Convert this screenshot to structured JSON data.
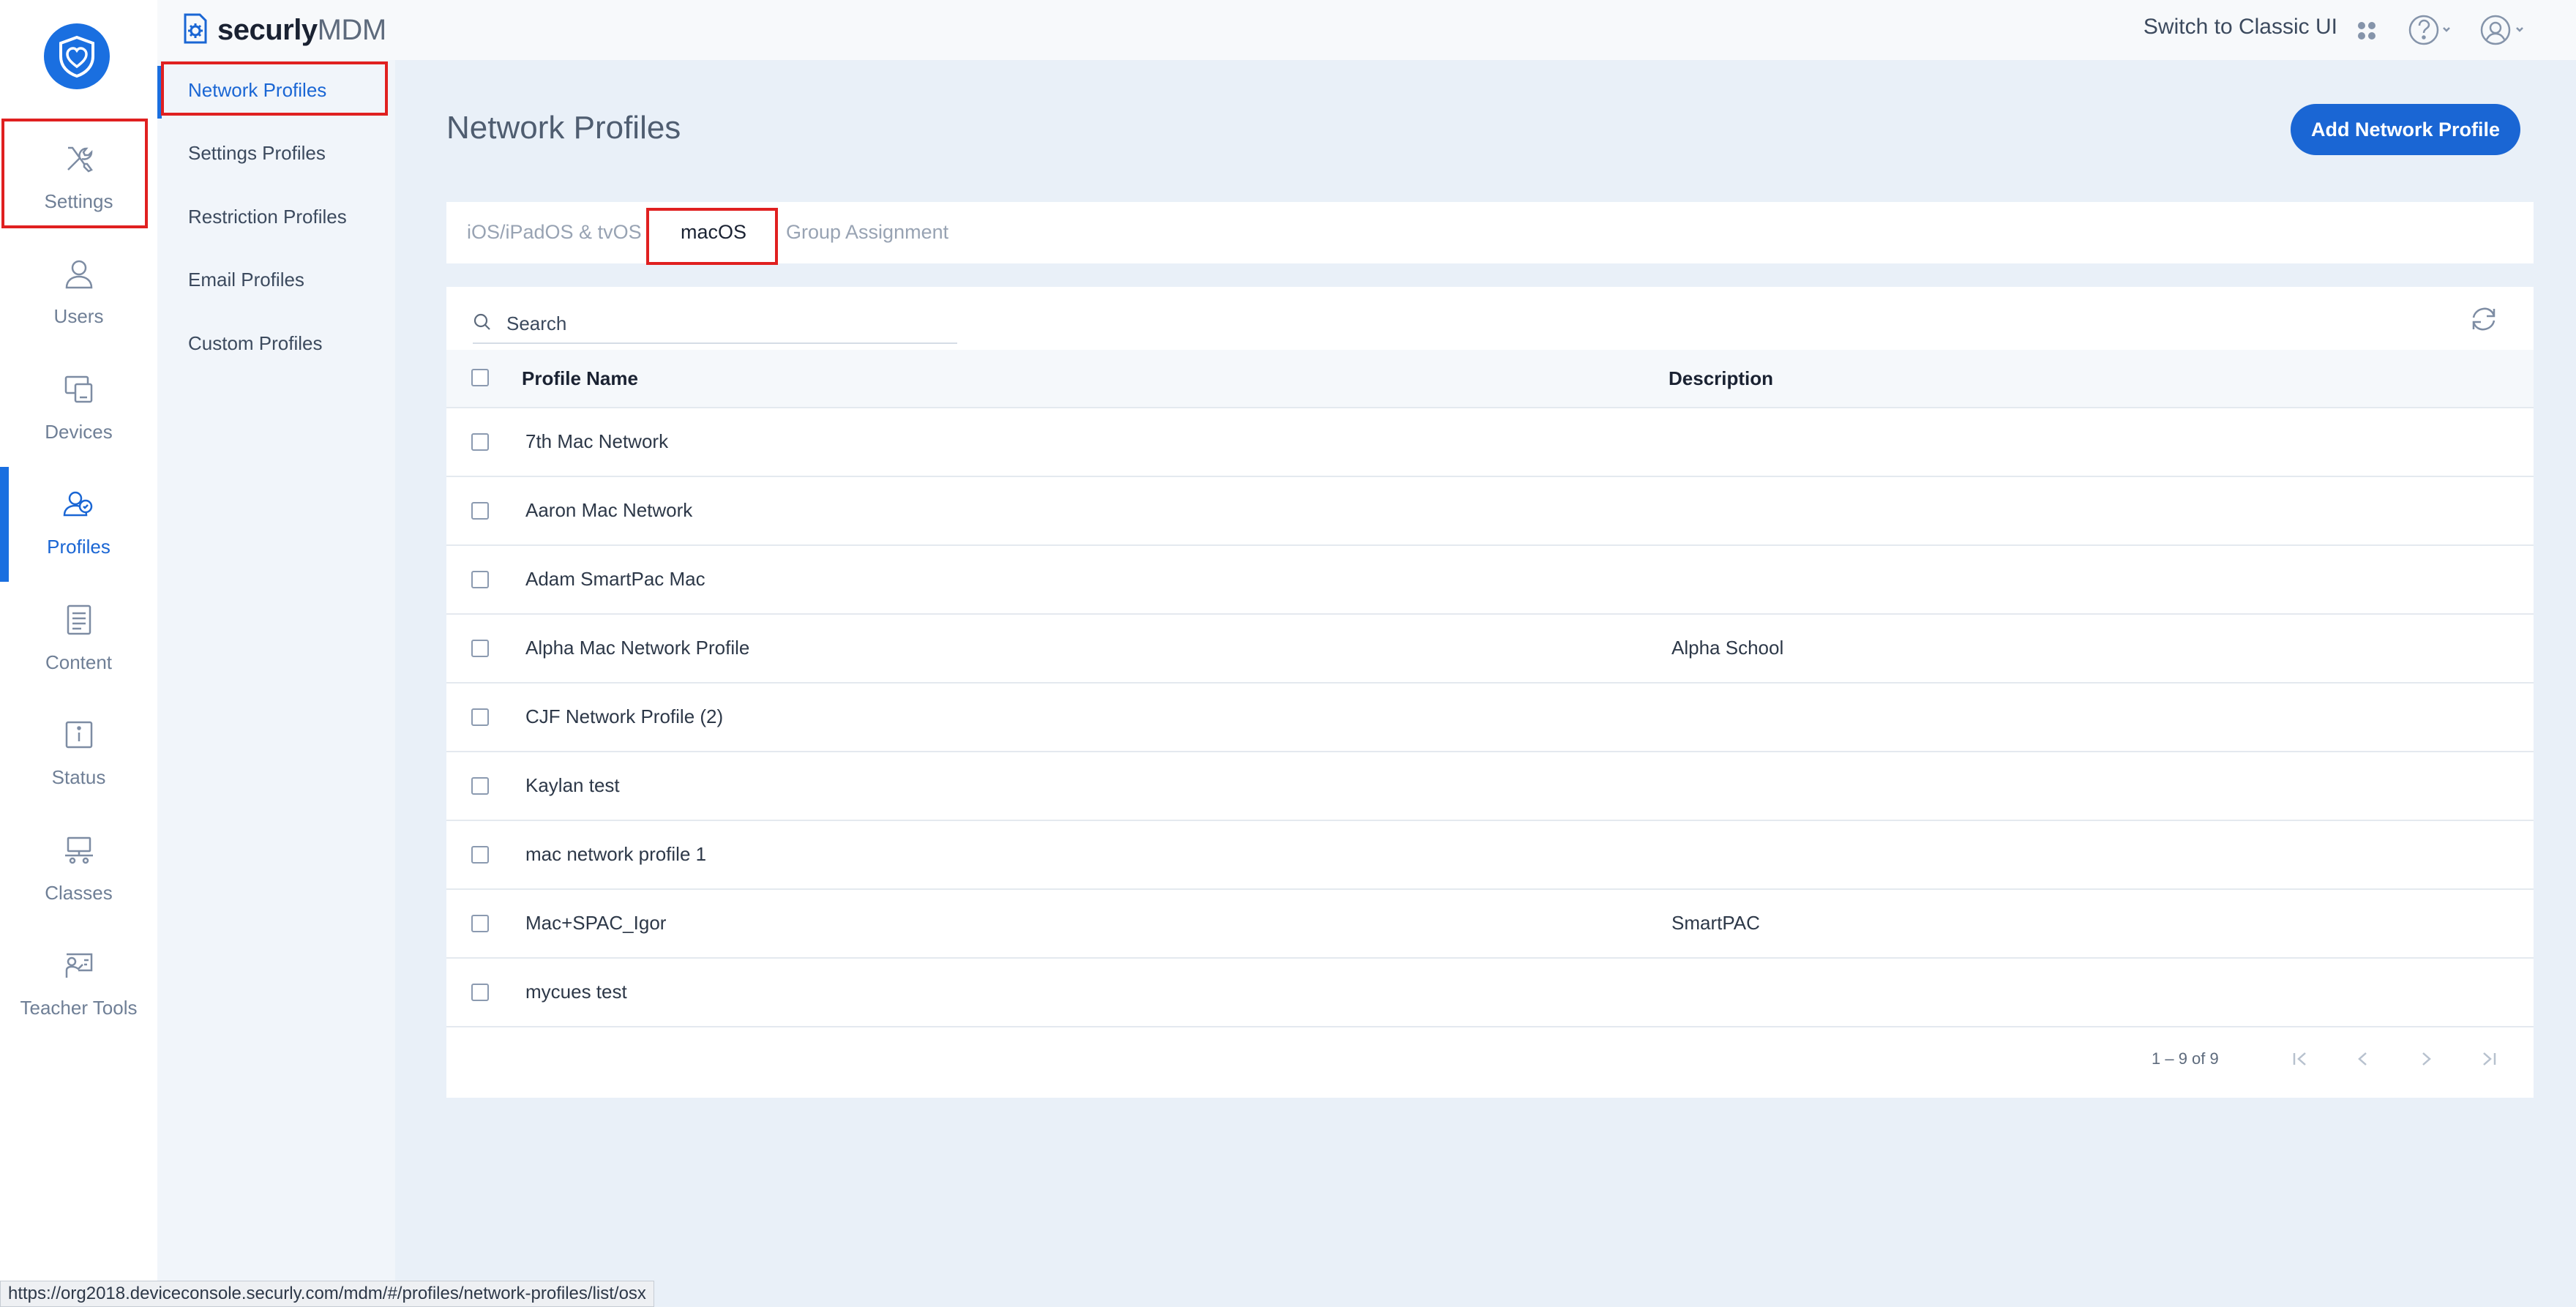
{
  "app": {
    "brand_strong": "securly",
    "brand_light": "MDM",
    "switch_classic": "Switch to Classic UI",
    "icons": {
      "logo": "shield-heart-icon",
      "apps": "apps-grid-icon",
      "help": "help-icon",
      "account": "account-icon"
    },
    "accent_color": "#1a66d4",
    "highlight_color": "#e02020"
  },
  "rail": {
    "items": [
      {
        "label": "Settings",
        "icon": "tools-icon"
      },
      {
        "label": "Users",
        "icon": "user-icon"
      },
      {
        "label": "Devices",
        "icon": "devices-icon"
      },
      {
        "label": "Profiles",
        "icon": "profiles-icon"
      },
      {
        "label": "Content",
        "icon": "document-icon"
      },
      {
        "label": "Status",
        "icon": "info-icon"
      },
      {
        "label": "Classes",
        "icon": "classroom-icon"
      },
      {
        "label": "Teacher Tools",
        "icon": "teacher-icon"
      }
    ],
    "active": "Profiles"
  },
  "subnav": {
    "items": [
      {
        "label": "Network Profiles"
      },
      {
        "label": "Settings Profiles"
      },
      {
        "label": "Restriction Profiles"
      },
      {
        "label": "Email Profiles"
      },
      {
        "label": "Custom Profiles"
      }
    ],
    "active": "Network Profiles"
  },
  "main": {
    "title": "Network Profiles",
    "add_button": "Add Network Profile",
    "tabs": [
      {
        "label": "iOS/iPadOS & tvOS"
      },
      {
        "label": "macOS"
      },
      {
        "label": "Group Assignment"
      }
    ],
    "active_tab": "macOS",
    "search": {
      "placeholder": "Search"
    },
    "columns": {
      "name": "Profile Name",
      "description": "Description"
    },
    "rows": [
      {
        "name": "7th Mac Network",
        "description": ""
      },
      {
        "name": "Aaron Mac Network",
        "description": ""
      },
      {
        "name": "Adam SmartPac Mac",
        "description": ""
      },
      {
        "name": "Alpha Mac Network Profile",
        "description": "Alpha School"
      },
      {
        "name": "CJF Network Profile (2)",
        "description": ""
      },
      {
        "name": "Kaylan test",
        "description": ""
      },
      {
        "name": "mac network profile 1",
        "description": ""
      },
      {
        "name": "Mac+SPAC_Igor",
        "description": "SmartPAC"
      },
      {
        "name": "mycues test",
        "description": ""
      }
    ],
    "pager": {
      "range": "1 – 9 of 9"
    }
  },
  "status_url": "https://org2018.deviceconsole.securly.com/mdm/#/profiles/network-profiles/list/osx"
}
